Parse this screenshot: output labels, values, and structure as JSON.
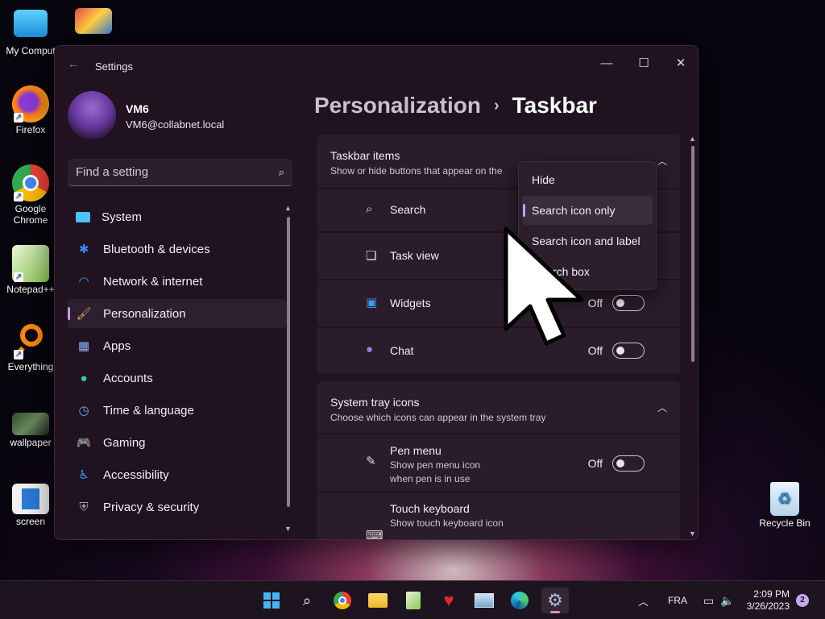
{
  "desktop": {
    "icons": [
      {
        "label": "My Comput"
      },
      {
        "label": ""
      },
      {
        "label": "Firefox"
      },
      {
        "label": "Google Chrome"
      },
      {
        "label": "Notepad++"
      },
      {
        "label": "Everything"
      },
      {
        "label": "wallpaper"
      },
      {
        "label": "screen"
      },
      {
        "label": "Recycle Bin"
      }
    ]
  },
  "window": {
    "title": "Settings",
    "back_icon": "back-arrow-icon",
    "minimize": "—",
    "maximize": "☐",
    "close": "✕"
  },
  "profile": {
    "name": "VM6",
    "email": "VM6@collabnet.local"
  },
  "search": {
    "placeholder": "Find a setting"
  },
  "nav": {
    "items": [
      {
        "label": "System",
        "icon": "system-icon",
        "color": "#4cc2ff"
      },
      {
        "label": "Bluetooth & devices",
        "icon": "bluetooth-icon",
        "color": "#2f8cff"
      },
      {
        "label": "Network & internet",
        "icon": "wifi-icon",
        "color": "#3b9cff"
      },
      {
        "label": "Personalization",
        "icon": "brush-icon",
        "color": "#e8a468"
      },
      {
        "label": "Apps",
        "icon": "apps-icon",
        "color": "#8ab4f8"
      },
      {
        "label": "Accounts",
        "icon": "accounts-icon",
        "color": "#38c8a0"
      },
      {
        "label": "Time & language",
        "icon": "time-language-icon",
        "color": "#5bb5f5"
      },
      {
        "label": "Gaming",
        "icon": "gaming-icon",
        "color": "#c9c9c9"
      },
      {
        "label": "Accessibility",
        "icon": "accessibility-icon",
        "color": "#3b9cff"
      },
      {
        "label": "Privacy & security",
        "icon": "shield-icon",
        "color": "#9aa3b0"
      }
    ],
    "active": "Personalization"
  },
  "breadcrumb": {
    "parent": "Personalization",
    "separator": "›",
    "current": "Taskbar"
  },
  "taskbar_items": {
    "title": "Taskbar items",
    "subtitle": "Show or hide buttons that appear on the",
    "rows": [
      {
        "label": "Search",
        "icon": "search-icon"
      },
      {
        "label": "Task view",
        "icon": "task-view-icon"
      },
      {
        "label": "Widgets",
        "icon": "widgets-icon",
        "state": "Off"
      },
      {
        "label": "Chat",
        "icon": "chat-icon",
        "state": "Off"
      }
    ]
  },
  "system_tray": {
    "title": "System tray icons",
    "subtitle": "Choose which icons can appear in the system tray",
    "rows": [
      {
        "label": "Pen menu",
        "sub1": "Show pen menu icon",
        "sub2": "when pen is in use",
        "icon": "pen-icon",
        "state": "Off"
      },
      {
        "label": "Touch keyboard",
        "sub1": "Show touch keyboard icon",
        "icon": "keyboard-icon"
      }
    ]
  },
  "dropdown": {
    "options": [
      "Hide",
      "Search icon only",
      "Search icon and label",
      "Search box"
    ],
    "selected": "Search icon only",
    "last_visible": "rch box"
  },
  "taskbar": {
    "apps": [
      "start-icon",
      "search-icon",
      "chrome-icon",
      "file-explorer-icon",
      "notepad-icon",
      "heart-app-icon",
      "photo-app-icon",
      "edge-icon",
      "settings-icon"
    ],
    "language": "FRA",
    "time": "2:09 PM",
    "date": "3/26/2023",
    "notifications": "2"
  }
}
